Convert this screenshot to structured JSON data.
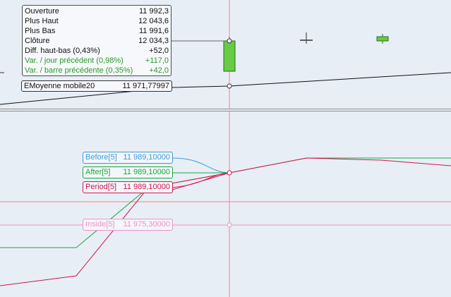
{
  "top_pane": {
    "info": [
      {
        "label": "Ouverture",
        "value": "11 992,3",
        "color": "#111111"
      },
      {
        "label": "Plus Haut",
        "value": "12 043,6",
        "color": "#111111"
      },
      {
        "label": "Plus Bas",
        "value": "11 991,6",
        "color": "#111111"
      },
      {
        "label": "Clôture",
        "value": "12 034,3",
        "color": "#111111"
      },
      {
        "label": "Diff. haut-bas (0,43%)",
        "value": "+52,0",
        "color": "#111111"
      },
      {
        "label": "Var. / jour précédent (0,98%)",
        "value": "+117,0",
        "color": "#2a9a2a"
      },
      {
        "label": "Var. / barre précédente (0,35%)",
        "value": "+42,0",
        "color": "#2a9a2a"
      }
    ],
    "ema": {
      "label": "EMoyenne mobile20",
      "value": "11 971,77997"
    }
  },
  "bottom_pane": {
    "tags": [
      {
        "label": "Before[5]",
        "value": "11 989,10000",
        "color": "#3a9bd6"
      },
      {
        "label": "After[5]",
        "value": "11 989,10000",
        "color": "#1aa83c"
      },
      {
        "label": "Period[5]",
        "value": "11 989,10000",
        "color": "#d4164a"
      },
      {
        "label": "Inside[5]",
        "value": "11 975,30000",
        "color": "#f090c8"
      }
    ]
  },
  "colors": {
    "background": "#e8eef6",
    "crosshair": "#ff7f8f",
    "candle_up": "#66cc44",
    "before": "#3a9bd6",
    "after": "#1aa83c",
    "period": "#d4164a",
    "inside": "#f090c8"
  }
}
